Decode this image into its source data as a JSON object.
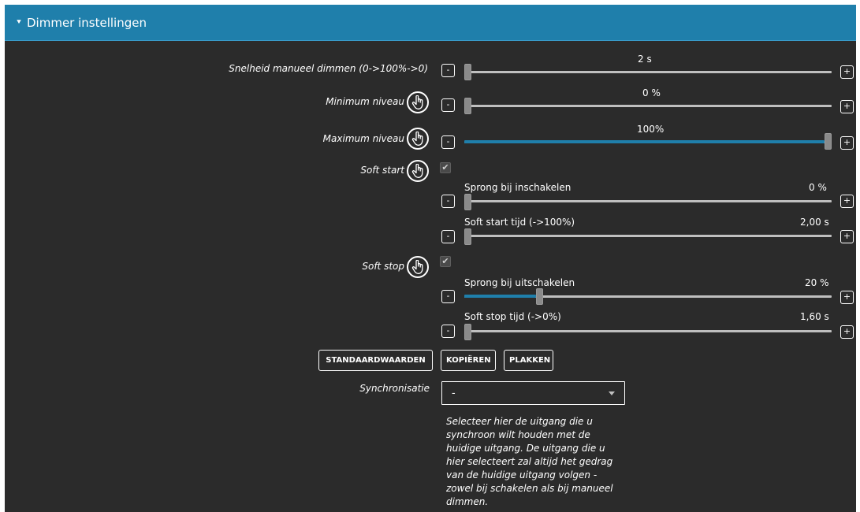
{
  "header": {
    "title": "Dimmer instellingen",
    "chevron": "chevron-down-icon"
  },
  "manual_speed": {
    "label": "Snelheid manueel dimmen (0->100%->0)",
    "value": "2 s",
    "level": 0.0
  },
  "min_level": {
    "label": "Minimum niveau",
    "value": "0 %",
    "level": 0.0
  },
  "max_level": {
    "label": "Maximum niveau",
    "value": "100%",
    "level": 1.0
  },
  "soft_start": {
    "label": "Soft start",
    "checked": true,
    "jump": {
      "label": "Sprong bij inschakelen",
      "value": "0 %",
      "level": 0.0
    },
    "time": {
      "label": "Soft start tijd (->100%)",
      "value": "2,00 s",
      "level": 0.0
    }
  },
  "soft_stop": {
    "label": "Soft stop",
    "checked": true,
    "jump": {
      "label": "Sprong bij uitschakelen",
      "value": "20 %",
      "level": 0.2
    },
    "time": {
      "label": "Soft stop tijd (->0%)",
      "value": "1,60 s",
      "level": 0.0
    }
  },
  "buttons": {
    "defaults": "STANDAARDWAARDEN",
    "copy": "KOPIËREN",
    "paste": "PLAKKEN",
    "minus": "-",
    "plus": "+"
  },
  "sync": {
    "label": "Synchronisatie",
    "value": "-",
    "help": "Selecteer hier de uitgang die u synchroon wilt houden met de huidige uitgang. De uitgang die u hier selecteert zal altijd het gedrag van de huidige uitgang volgen - zowel bij schakelen als bij manueel dimmen."
  },
  "colors": {
    "accent": "#1f7fab",
    "background": "#2b2b2b"
  }
}
